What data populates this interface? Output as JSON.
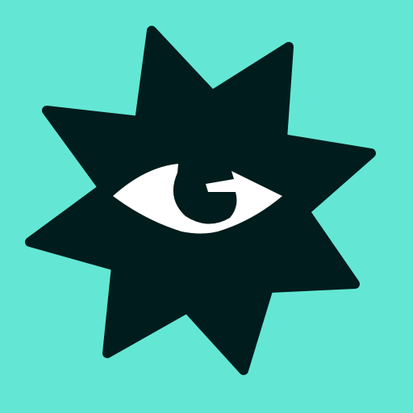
{
  "icon": {
    "name": "app-icon",
    "shape": "nine-point-star",
    "emblem": "eye-with-curved-arrow"
  },
  "colors": {
    "background": "#63e7d4",
    "star": "#011c1c",
    "eye": "#ffffff",
    "pupil": "#011c1c"
  }
}
